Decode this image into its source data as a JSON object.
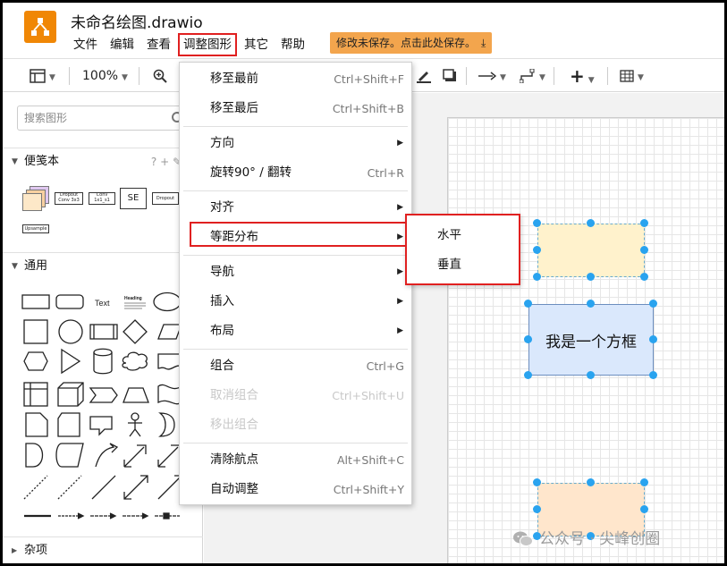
{
  "app": {
    "title": "未命名绘图.drawio",
    "save_notice": "修改未保存。点击此处保存。",
    "colors": {
      "logo": "#f08705",
      "highlight": "#e02020",
      "selection_handle": "#29a3ef",
      "save_notice_bg": "#f3a54d"
    }
  },
  "menubar": {
    "items": [
      {
        "label": "文件"
      },
      {
        "label": "编辑"
      },
      {
        "label": "查看"
      },
      {
        "label": "调整图形",
        "active": true
      },
      {
        "label": "其它"
      },
      {
        "label": "帮助"
      }
    ]
  },
  "toolbar": {
    "page_view_icon": "page-view-icon",
    "zoom": "100%",
    "zoom_in_icon": "zoom-in-icon",
    "line_color_icon": "pen-icon",
    "shadow_icon": "shadow-icon",
    "connection_icon": "arrow-right-icon",
    "waypoint_icon": "waypoint-icon",
    "insert_icon": "plus-icon",
    "table_icon": "table-icon"
  },
  "sidebar": {
    "search_placeholder": "搜索图形",
    "sections": [
      {
        "label": "便笺本",
        "tools": "? + ✎"
      },
      {
        "label": "通用"
      },
      {
        "label": "杂项"
      }
    ],
    "scratchpad_items": [
      "Dropout Conv 3x3",
      "Conv 1x1_s1",
      "SE",
      "Dropout",
      "Upsample"
    ],
    "general_text_shape": "Text",
    "general_heading_shape": "Heading"
  },
  "menu_adjust": {
    "items": [
      {
        "label": "移至最前",
        "shortcut": "Ctrl+Shift+F"
      },
      {
        "label": "移至最后",
        "shortcut": "Ctrl+Shift+B"
      },
      {
        "label": "方向",
        "submenu": true
      },
      {
        "label": "旋转90° / 翻转",
        "shortcut": "Ctrl+R"
      },
      {
        "label": "对齐",
        "submenu": true
      },
      {
        "label": "等距分布",
        "submenu": true,
        "highlighted": true
      },
      {
        "label": "导航",
        "submenu": true
      },
      {
        "label": "插入",
        "submenu": true
      },
      {
        "label": "布局",
        "submenu": true
      },
      {
        "label": "组合",
        "shortcut": "Ctrl+G"
      },
      {
        "label": "取消组合",
        "shortcut": "Ctrl+Shift+U",
        "disabled": true
      },
      {
        "label": "移出组合",
        "disabled": true
      },
      {
        "label": "清除航点",
        "shortcut": "Alt+Shift+C"
      },
      {
        "label": "自动调整",
        "shortcut": "Ctrl+Shift+Y"
      }
    ]
  },
  "submenu_distribute": {
    "items": [
      {
        "label": "水平"
      },
      {
        "label": "垂直"
      }
    ]
  },
  "canvas": {
    "shapes": [
      {
        "text": "",
        "fill": "#fff2cc",
        "stroke": "#d6b656"
      },
      {
        "text": "我是一个方框",
        "fill": "#dae8fc",
        "stroke": "#6c8ebf"
      },
      {
        "text": "",
        "fill": "#ffe6cc",
        "stroke": "#d79b00"
      }
    ]
  },
  "watermark": "公众号 · 尖峰创圈"
}
